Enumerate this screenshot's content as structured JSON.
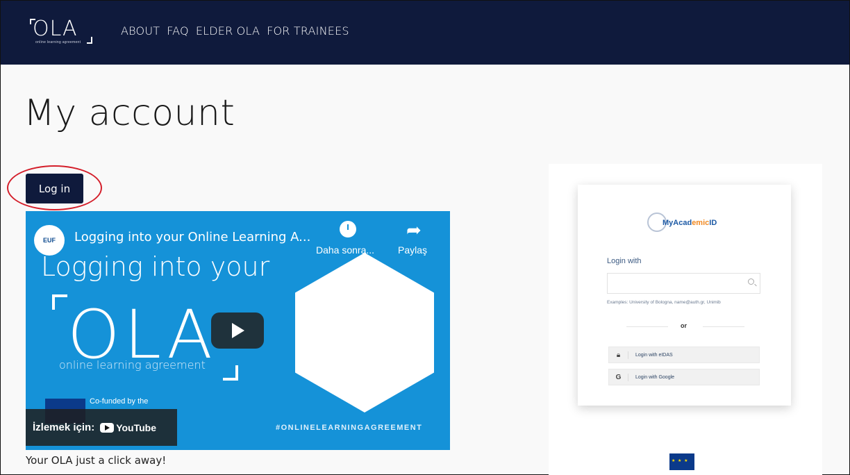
{
  "header": {
    "logo_text": "OLA",
    "logo_tagline": "online learning agreement",
    "nav": [
      "ABOUT",
      "FAQ",
      "ELDER OLA",
      "FOR TRAINEES"
    ]
  },
  "main": {
    "title": "My account",
    "login_button": "Log in",
    "caption": "Your OLA just a click away!"
  },
  "video": {
    "channel_logo": "EUF",
    "title": "Logging into your Online Learning A...",
    "watch_later": "Daha sonra...",
    "share": "Paylaş",
    "headline": "Logging into your",
    "ola": "OLA",
    "ola_subtitle": "online learning agreement",
    "cofunded": "Co-funded by the",
    "hashtag": "#ONLINELEARNINGAGREEMENT",
    "watch_on": "İzlemek için:",
    "youtube": "YouTube"
  },
  "login_card": {
    "brand": "MyAcademicID",
    "brand_a": "MyAcad",
    "brand_b": "emic",
    "brand_c": "ID",
    "login_with": "Login with",
    "search_placeholder": "",
    "examples": "Examples: University of Bologna, name@auth.gr, Unimib",
    "or": "or",
    "eidas": "Login with eIDAS",
    "google": "Login with Google"
  },
  "colors": {
    "navy": "#0f1a3c",
    "highlight": "#d41f2b",
    "video_bg": "#1592d8"
  }
}
